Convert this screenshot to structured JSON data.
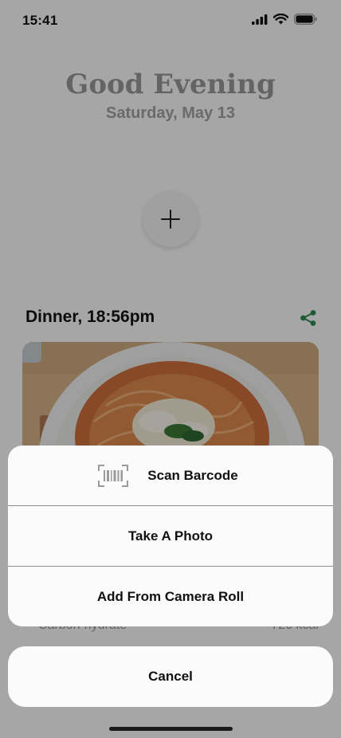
{
  "status_bar": {
    "time": "15:41",
    "icons": [
      "cellular-signal-icon",
      "wifi-icon",
      "battery-icon"
    ]
  },
  "header": {
    "greeting": "Good Evening",
    "date": "Saturday, May 13"
  },
  "add_button": {
    "icon": "plus-icon"
  },
  "meal": {
    "title": "Dinner, 18:56pm",
    "share_icon": "share-icon",
    "photo": "plate of spaghetti with tomato sauce, grated cheese and basil",
    "nutrient_row": {
      "label": "Carbon-hydrate",
      "value": "720 kcal"
    }
  },
  "action_sheet": {
    "items": [
      {
        "label": "Scan Barcode",
        "icon": "barcode-scan-icon"
      },
      {
        "label": "Take A Photo"
      },
      {
        "label": "Add From Camera Roll"
      }
    ],
    "cancel_label": "Cancel"
  },
  "colors": {
    "sheet_background": "#fbfbfb",
    "overlay": "rgba(0,0,0,0.35)",
    "share_accent": "#2f8a54",
    "greeting_text": "#9a9a9a"
  }
}
